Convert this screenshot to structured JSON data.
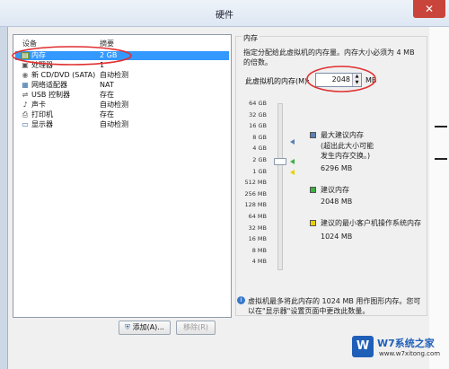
{
  "window": {
    "title": "硬件",
    "close_glyph": "✕"
  },
  "devices": {
    "col_device": "设备",
    "col_summary": "摘要",
    "items": [
      {
        "name": "内存",
        "summary": "2 GB",
        "icon": "ram-icon",
        "selected": true
      },
      {
        "name": "处理器",
        "summary": "1",
        "icon": "cpu-icon"
      },
      {
        "name": "新 CD/DVD (SATA)",
        "summary": "自动检测",
        "icon": "cd-dvd-icon"
      },
      {
        "name": "网络适配器",
        "summary": "NAT",
        "icon": "network-adapter-icon"
      },
      {
        "name": "USB 控制器",
        "summary": "存在",
        "icon": "usb-icon"
      },
      {
        "name": "声卡",
        "summary": "自动检测",
        "icon": "sound-card-icon"
      },
      {
        "name": "打印机",
        "summary": "存在",
        "icon": "printer-icon"
      },
      {
        "name": "显示器",
        "summary": "自动检测",
        "icon": "display-icon"
      }
    ],
    "add_button": "添加(A)...",
    "remove_button": "移除(R)"
  },
  "memory": {
    "legend": "内存",
    "description": "指定分配给此虚拟机的内存量。内存大小必须为 4 MB 的倍数。",
    "field_label": "此虚拟机的内存(M):",
    "value": "2048",
    "unit": "MB",
    "scale": [
      "64 GB",
      "32 GB",
      "16 GB",
      "8 GB",
      "4 GB",
      "2 GB",
      "1 GB",
      "512 MB",
      "256 MB",
      "128 MB",
      "64 MB",
      "32 MB",
      "16 MB",
      "8 MB",
      "4 MB"
    ],
    "max_recommended_label": "最大建议内存",
    "max_recommended_note_1": "(超出此大小可能",
    "max_recommended_note_2": "发生内存交换。)",
    "max_recommended_value": "6296 MB",
    "recommended_label": "建议内存",
    "recommended_value": "2048 MB",
    "min_guest_label": "建议的最小客户机操作系统内存",
    "min_guest_value": "1024 MB",
    "colors": {
      "max": "#5b7fb5",
      "recommended": "#3cb043",
      "min": "#e8d000"
    },
    "info_text": "虚拟机最多将此内存的 1024 MB 用作图形内存。您可以在\"显示器\"设置页面中更改此数量。"
  },
  "watermark": {
    "logo": "W",
    "name": "W7系统之家",
    "url": "www.w7xitong.com"
  }
}
